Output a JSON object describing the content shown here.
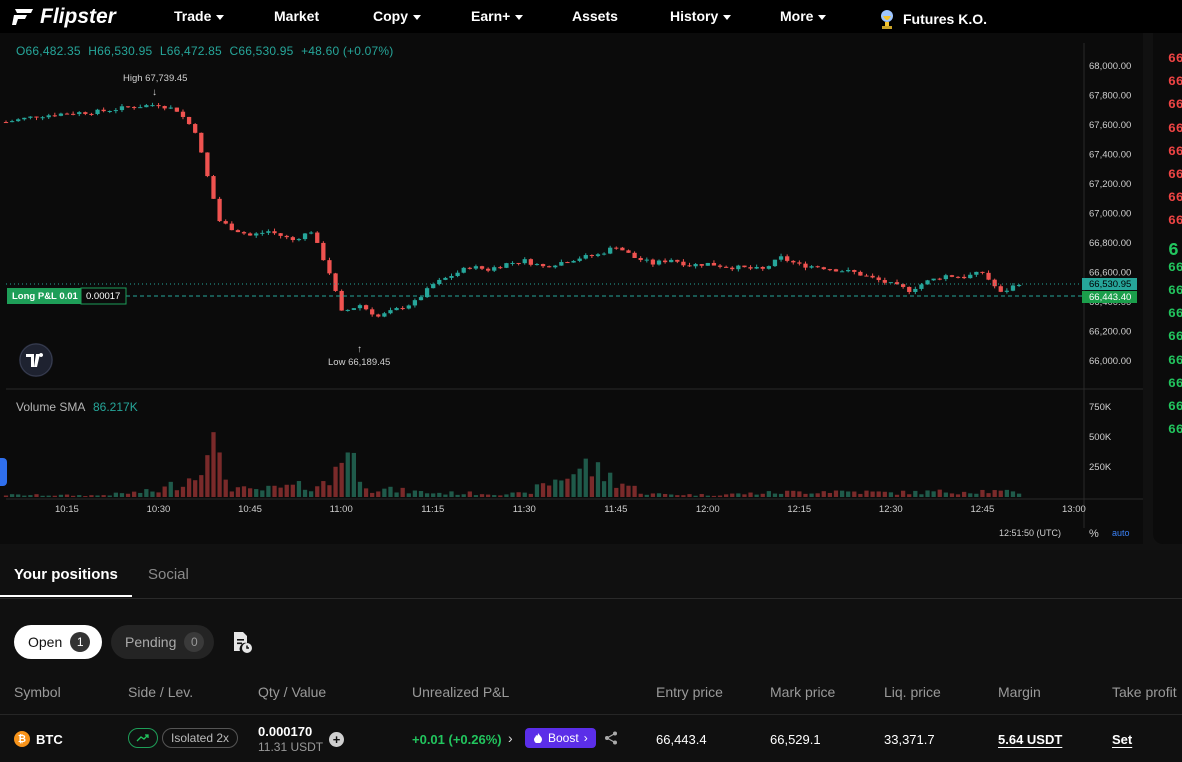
{
  "topnav": {
    "logo": "Flipster",
    "items": [
      {
        "label": "Trade",
        "dropdown": true
      },
      {
        "label": "Market",
        "dropdown": false
      },
      {
        "label": "Copy",
        "dropdown": true
      },
      {
        "label": "Earn+",
        "dropdown": true
      },
      {
        "label": "Assets",
        "dropdown": false
      },
      {
        "label": "History",
        "dropdown": true
      },
      {
        "label": "More",
        "dropdown": true
      }
    ],
    "futures_ko": "Futures K.O."
  },
  "chart": {
    "ohlc": {
      "open": "O66,482.35",
      "high": "H66,530.95",
      "low": "L66,472.85",
      "close": "C66,530.95",
      "change": "+48.60 (+0.07%)"
    },
    "high_marker": "High 67,739.45",
    "low_marker": "Low 66,189.45",
    "price_ticks": [
      "68,000.00",
      "67,800.00",
      "67,600.00",
      "67,400.00",
      "67,200.00",
      "67,000.00",
      "66,800.00",
      "66,600.00",
      "66,400.00",
      "66,200.00",
      "66,000.00"
    ],
    "current_price_tag": "66,530.95",
    "entry_price_tag": "66,443.40",
    "long_pnl_label": "Long P&L 0.01",
    "long_pnl_value": "0.00017",
    "volume_label": "Volume SMA",
    "volume_value": "86.217K",
    "volume_ticks": [
      "750K",
      "500K",
      "250K"
    ],
    "time_ticks": [
      "10:15",
      "10:30",
      "10:45",
      "11:00",
      "11:15",
      "11:30",
      "11:45",
      "12:00",
      "12:15",
      "12:30",
      "12:45",
      "13:00"
    ],
    "clock": "12:51:50 (UTC)",
    "percent_toggle": "%",
    "auto_toggle": "auto",
    "colors": {
      "up": "#26a69a",
      "down": "#ef5350",
      "up_bright": "#22c55e"
    }
  },
  "chart_data": {
    "type": "candlestick",
    "title": "",
    "x_range": [
      "10:05",
      "13:00"
    ],
    "y_range": [
      65900,
      68100
    ],
    "high": 67739.45,
    "low": 66189.45,
    "last": 66530.95,
    "entry": 66443.4,
    "close_path": [
      [
        "10:05",
        67620
      ],
      [
        "10:10",
        67660
      ],
      [
        "10:15",
        67680
      ],
      [
        "10:20",
        67690
      ],
      [
        "10:25",
        67720
      ],
      [
        "10:30",
        67740
      ],
      [
        "10:33",
        67700
      ],
      [
        "10:36",
        67560
      ],
      [
        "10:38",
        67250
      ],
      [
        "10:40",
        66950
      ],
      [
        "10:42",
        66900
      ],
      [
        "10:45",
        66850
      ],
      [
        "10:48",
        66880
      ],
      [
        "10:52",
        66820
      ],
      [
        "10:55",
        66880
      ],
      [
        "10:58",
        66600
      ],
      [
        "11:00",
        66330
      ],
      [
        "11:03",
        66380
      ],
      [
        "11:06",
        66300
      ],
      [
        "11:09",
        66350
      ],
      [
        "11:12",
        66400
      ],
      [
        "11:15",
        66520
      ],
      [
        "11:18",
        66580
      ],
      [
        "11:21",
        66640
      ],
      [
        "11:24",
        66620
      ],
      [
        "11:27",
        66660
      ],
      [
        "11:30",
        66680
      ],
      [
        "11:33",
        66640
      ],
      [
        "11:36",
        66670
      ],
      [
        "11:39",
        66700
      ],
      [
        "11:42",
        66720
      ],
      [
        "11:45",
        66780
      ],
      [
        "11:48",
        66700
      ],
      [
        "11:51",
        66660
      ],
      [
        "11:54",
        66690
      ],
      [
        "11:57",
        66650
      ],
      [
        "12:00",
        66660
      ],
      [
        "12:03",
        66640
      ],
      [
        "12:06",
        66630
      ],
      [
        "12:09",
        66620
      ],
      [
        "12:12",
        66700
      ],
      [
        "12:15",
        66650
      ],
      [
        "12:18",
        66640
      ],
      [
        "12:21",
        66620
      ],
      [
        "12:24",
        66600
      ],
      [
        "12:27",
        66560
      ],
      [
        "12:30",
        66520
      ],
      [
        "12:33",
        66480
      ],
      [
        "12:36",
        66540
      ],
      [
        "12:39",
        66580
      ],
      [
        "12:42",
        66570
      ],
      [
        "12:45",
        66600
      ],
      [
        "12:48",
        66460
      ],
      [
        "12:51",
        66530
      ]
    ],
    "volume_path": [
      [
        "10:05",
        20000
      ],
      [
        "10:20",
        15000
      ],
      [
        "10:30",
        60000
      ],
      [
        "10:36",
        210000
      ],
      [
        "10:38",
        700000
      ],
      [
        "10:40",
        300000
      ],
      [
        "10:42",
        100000
      ],
      [
        "10:45",
        60000
      ],
      [
        "10:58",
        130000
      ],
      [
        "11:00",
        520000
      ],
      [
        "11:05",
        80000
      ],
      [
        "11:15",
        40000
      ],
      [
        "11:30",
        30000
      ],
      [
        "11:40",
        300000
      ],
      [
        "11:50",
        30000
      ],
      [
        "12:00",
        20000
      ],
      [
        "12:15",
        50000
      ],
      [
        "12:20",
        60000
      ],
      [
        "12:30",
        40000
      ],
      [
        "12:45",
        60000
      ],
      [
        "12:51",
        40000
      ]
    ]
  },
  "right_strip": {
    "prices": [
      {
        "text": "66",
        "color": "red"
      },
      {
        "text": "66",
        "color": "red"
      },
      {
        "text": "66",
        "color": "red"
      },
      {
        "text": "66",
        "color": "red"
      },
      {
        "text": "66",
        "color": "red"
      },
      {
        "text": "66",
        "color": "red"
      },
      {
        "text": "66",
        "color": "red"
      },
      {
        "text": "66",
        "color": "red"
      },
      {
        "text": "6",
        "color": "green"
      },
      {
        "text": "66",
        "color": "green"
      },
      {
        "text": "66",
        "color": "green"
      },
      {
        "text": "66",
        "color": "green"
      },
      {
        "text": "66",
        "color": "green"
      },
      {
        "text": "66",
        "color": "green"
      },
      {
        "text": "66",
        "color": "green"
      },
      {
        "text": "66",
        "color": "green"
      },
      {
        "text": "66",
        "color": "green"
      }
    ]
  },
  "positions": {
    "tabs": [
      "Your positions",
      "Social"
    ],
    "filters": {
      "open_label": "Open",
      "open_count": "1",
      "pending_label": "Pending",
      "pending_count": "0"
    },
    "columns": [
      "Symbol",
      "Side / Lev.",
      "Qty / Value",
      "Unrealized P&L",
      "Entry price",
      "Mark price",
      "Liq. price",
      "Margin",
      "Take profit"
    ],
    "row": {
      "symbol": "BTC",
      "side_icon": "trend-up-icon",
      "leverage": "Isolated 2x",
      "qty": "0.000170",
      "value": "11.31 USDT",
      "pnl": "+0.01 (+0.26%)",
      "boost": "Boost",
      "entry_price": "66,443.4",
      "mark_price": "66,529.1",
      "liq_price": "33,371.7",
      "margin": "5.64 USDT",
      "take_profit": "Set"
    }
  }
}
